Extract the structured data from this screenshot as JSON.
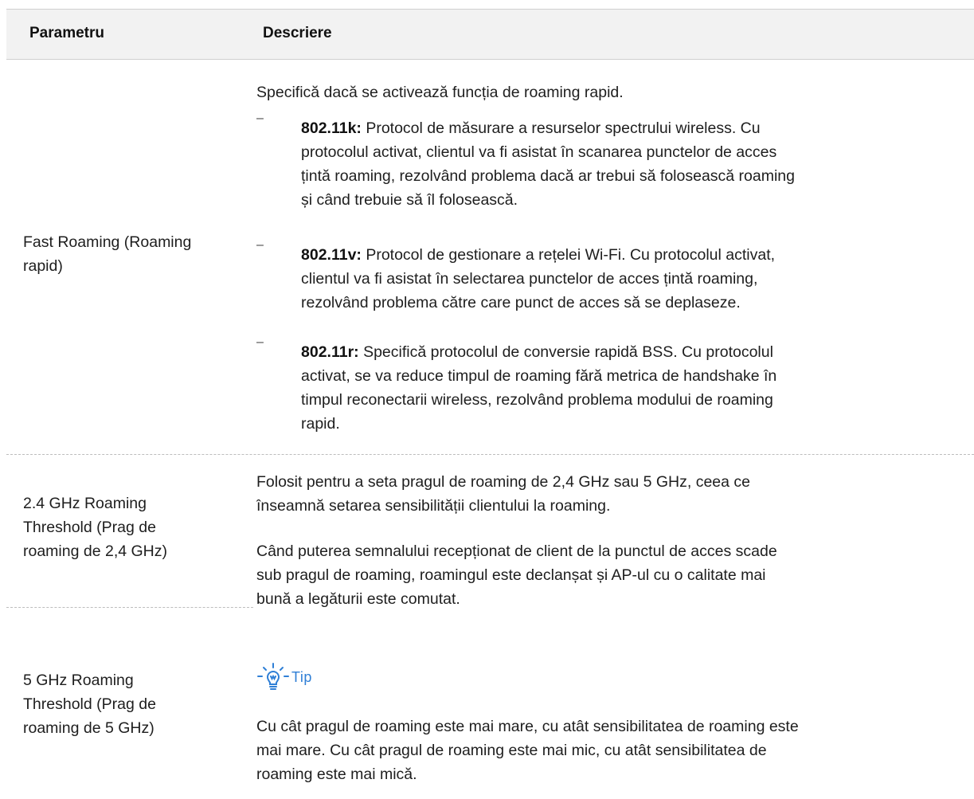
{
  "table": {
    "headers": [
      "Parametru",
      "Descriere"
    ],
    "row_fast_roaming": {
      "param_line1": "Fast Roaming (Roaming",
      "param_line2": "rapid)",
      "intro": "Specifică dacă se activează funcția de roaming rapid.",
      "bullets": [
        {
          "term": "802.11k:",
          "lines": [
            " Protocol de măsurare a resurselor spectrului wireless. Cu",
            "protocolul activat, clientul va fi asistat în scanarea punctelor de acces",
            "țintă roaming, rezolvând problema dacă ar trebui să folosească roaming",
            "și când trebuie să îl folosească."
          ]
        },
        {
          "term": "802.11v:",
          "lines": [
            " Protocol de gestionare a rețelei Wi-Fi. Cu protocolul activat,",
            "clientul va fi asistat în selectarea punctelor de acces țintă roaming,",
            "rezolvând problema către care punct de acces să se deplaseze."
          ]
        },
        {
          "term": "802.11r:",
          "lines": [
            " Specifică protocolul de conversie rapidă BSS. Cu protocolul",
            "activat, se va reduce timpul de roaming fără metrica de handshake în",
            "timpul reconectarii wireless, rezolvând problema modului de roaming",
            "rapid."
          ]
        }
      ]
    },
    "row_threshold_24": {
      "param_lines": [
        "2.4 GHz Roaming",
        "Threshold (Prag de",
        "roaming de 2,4 GHz)"
      ]
    },
    "row_threshold_5": {
      "param_lines": [
        "5 GHz Roaming",
        "Threshold (Prag de",
        "roaming de 5 GHz)"
      ]
    },
    "threshold_desc": {
      "p1_lines": [
        "Folosit pentru a seta pragul de roaming de 2,4 GHz sau 5 GHz, ceea ce",
        "înseamnă setarea sensibilității clientului la roaming."
      ],
      "p2_lines": [
        "Când puterea semnalului recepționat de client de la punctul de acces scade",
        "sub pragul de roaming, roamingul este declanșat și AP-ul cu o calitate mai",
        "bună a legăturii este comutat."
      ],
      "tip_label": "Tip",
      "tip_icon": "lightbulb-icon",
      "tip_lines": [
        "Cu cât pragul de roaming este mai mare, cu atât sensibilitatea de roaming este",
        "mai mare. Cu cât pragul de roaming este mai mic, cu atât sensibilitatea de",
        "roaming este mai mică."
      ]
    }
  },
  "colors": {
    "header_bg": "#f2f2f2",
    "tip_accent": "#2f7fd6",
    "rule": "#bdbdbd"
  }
}
